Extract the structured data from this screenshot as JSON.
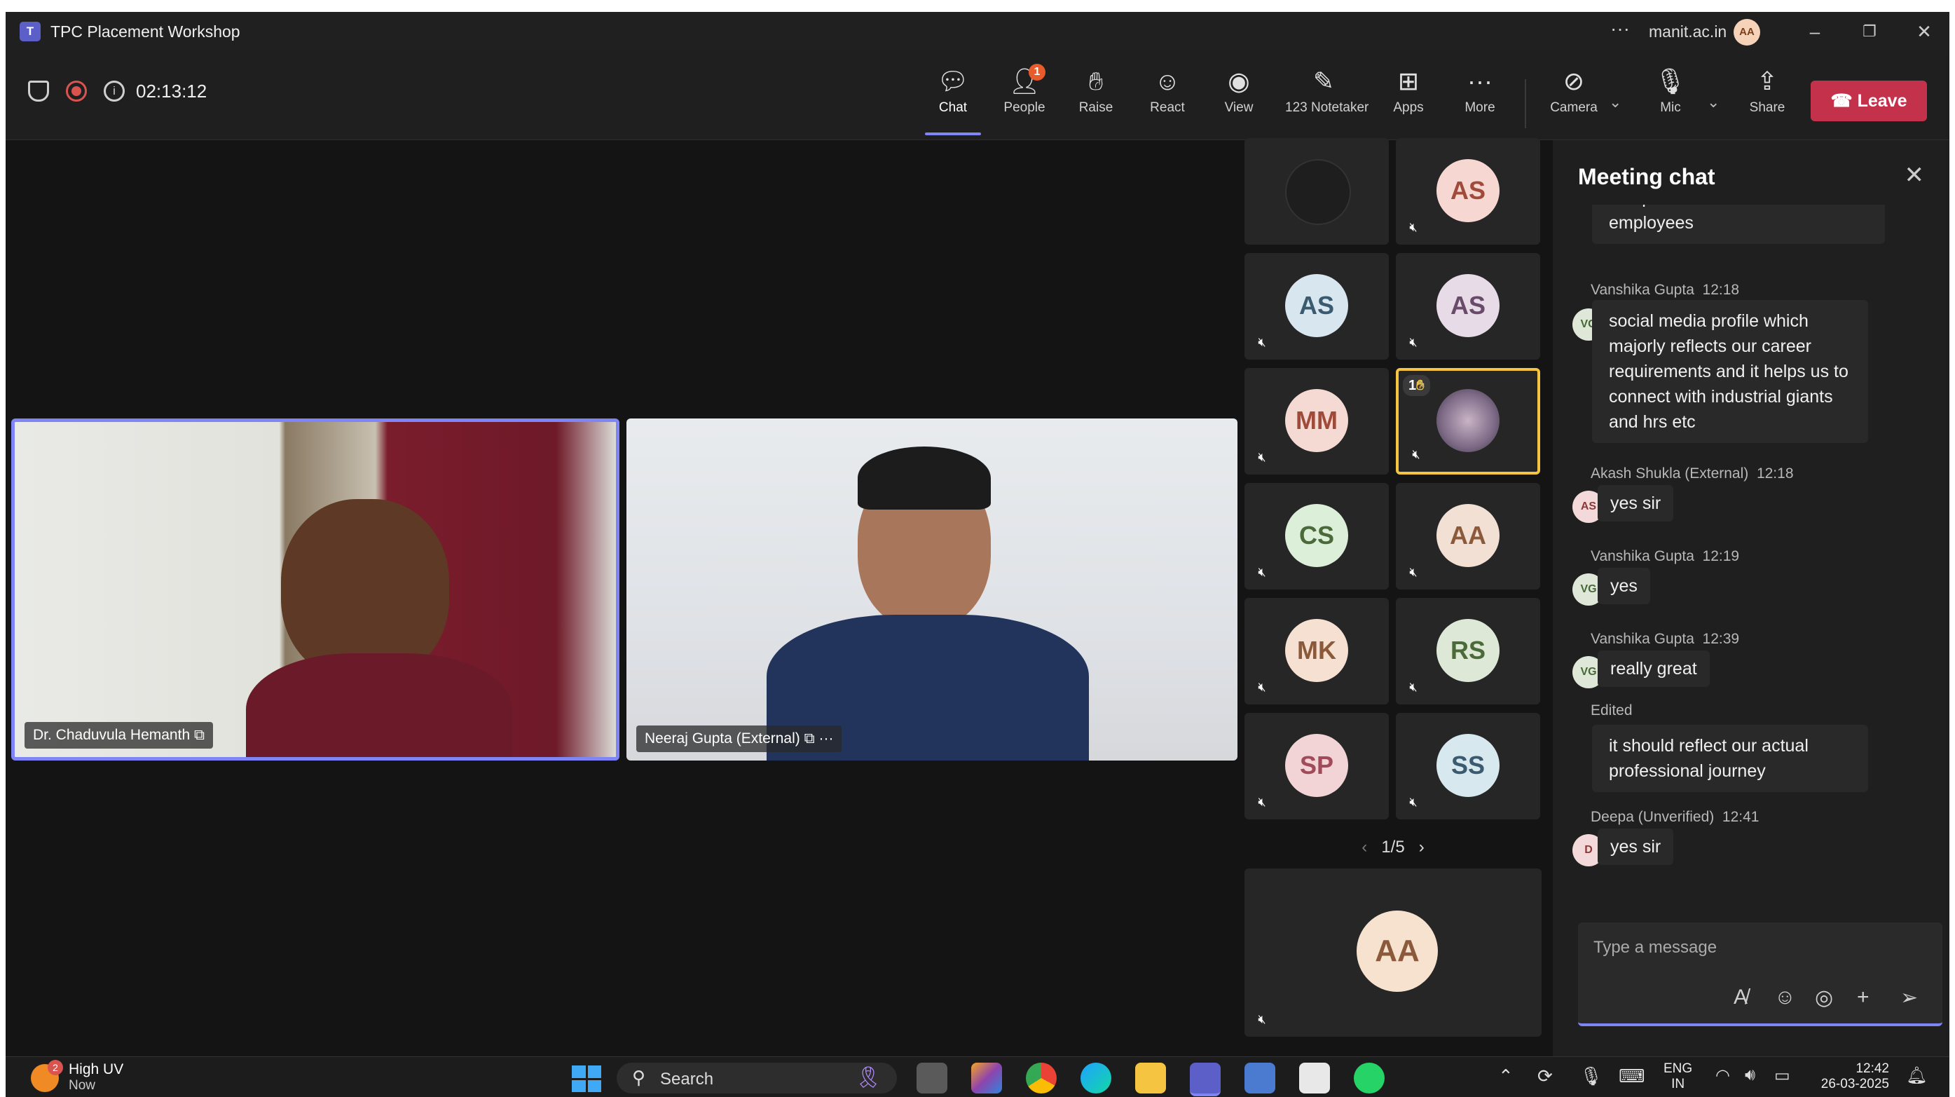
{
  "window": {
    "title": "TPC Placement Workshop",
    "org": "manit.ac.in",
    "avatar_initials": "AA"
  },
  "toolbar": {
    "timer": "02:13:12",
    "buttons": [
      {
        "label": "Chat"
      },
      {
        "label": "People",
        "badge": "1"
      },
      {
        "label": "Raise"
      },
      {
        "label": "React"
      },
      {
        "label": "View"
      },
      {
        "label": "123 Notetaker"
      },
      {
        "label": "Apps"
      },
      {
        "label": "More"
      },
      {
        "label": "Camera"
      },
      {
        "label": "Mic"
      },
      {
        "label": "Share"
      }
    ],
    "leave_label": "Leave"
  },
  "stage": {
    "tiles": [
      {
        "name": "Dr. Chaduvula Hemanth"
      },
      {
        "name": "Neeraj Gupta (External)"
      }
    ]
  },
  "grid": {
    "participants": [
      {
        "initials": "",
        "color": "#1e1e1e"
      },
      {
        "initials": "AS",
        "color": "#f7d7d2"
      },
      {
        "initials": "AS",
        "color": "#d8e6f0"
      },
      {
        "initials": "AS",
        "color": "#e8dbe8"
      },
      {
        "initials": "MM",
        "color": "#f5d9d3"
      },
      {
        "initials": "",
        "raised_count": "1",
        "color": "#8e7b9a"
      },
      {
        "initials": "CS",
        "color": "#dcefd8"
      },
      {
        "initials": "AA",
        "color": "#f3e0d4"
      },
      {
        "initials": "MK",
        "color": "#f6e0d2"
      },
      {
        "initials": "RS",
        "color": "#dde8d6"
      },
      {
        "initials": "SP",
        "color": "#f3d4d6"
      },
      {
        "initials": "SS",
        "color": "#d8e8ef"
      }
    ],
    "pagination": "1/5",
    "featured": {
      "initials": "AA",
      "color": "#f6e2cf"
    }
  },
  "chat": {
    "title": "Meeting chat",
    "messages": [
      {
        "text_lines": [
          "companies/offices and",
          "employees"
        ]
      },
      {
        "sender": "Vanshika Gupta",
        "time": "12:18",
        "avatar": "VG",
        "text_lines": [
          "social media profile which",
          "majorly reflects our career",
          "requirements and it helps us to",
          "connect with industrial giants",
          "and hrs etc"
        ]
      },
      {
        "sender": "Akash Shukla (External)",
        "time": "12:18",
        "avatar": "AS",
        "text_lines": [
          "yes sir"
        ]
      },
      {
        "sender": "Vanshika Gupta",
        "time": "12:19",
        "avatar": "VG",
        "text_lines": [
          "yes"
        ]
      },
      {
        "sender": "Vanshika Gupta",
        "time": "12:39",
        "avatar": "VG",
        "text_lines": [
          "really great"
        ]
      },
      {
        "edited_label": "Edited",
        "text_lines": [
          "it should reflect our actual",
          "professional journey"
        ]
      },
      {
        "sender": "Deepa (Unverified)",
        "time": "12:41",
        "avatar": "D",
        "text_lines": [
          "yes sir"
        ]
      }
    ],
    "composer_placeholder": "Type a message"
  },
  "taskbar": {
    "weather": {
      "badge": "2",
      "title": "High UV",
      "subtitle": "Now"
    },
    "search_label": "Search",
    "tray": {
      "lang_line1": "ENG",
      "lang_line2": "IN",
      "time": "12:42",
      "date": "26-03-2025"
    }
  }
}
